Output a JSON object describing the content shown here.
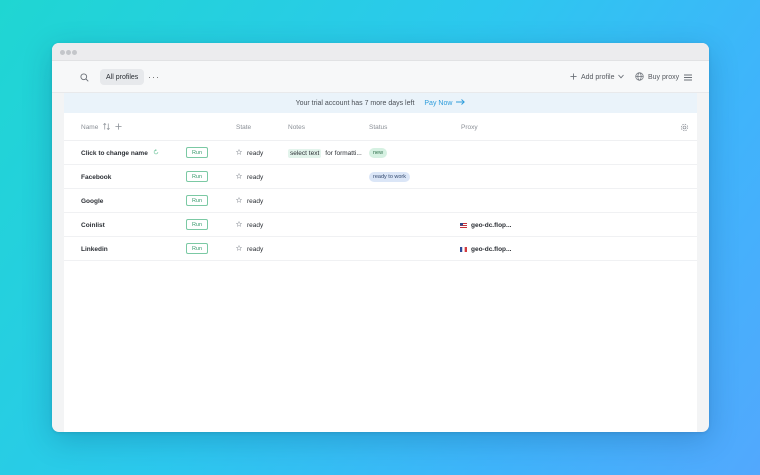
{
  "toolbar": {
    "tab_label": "All profiles",
    "more_label": "···",
    "add_profile_label": "Add profile",
    "buy_proxy_label": "Buy proxy"
  },
  "banner": {
    "text": "Your trial account has 7 more days left",
    "action_label": "Pay Now"
  },
  "table": {
    "columns": {
      "name": "Name",
      "state": "State",
      "notes": "Notes",
      "status": "Status",
      "proxy": "Proxy"
    },
    "run_label": "Run",
    "rows": [
      {
        "name": "Click to change name",
        "state": "ready",
        "notes_highlight": "select text",
        "notes_rest": "for formatti...",
        "status": "new",
        "proxy": "",
        "proxy_flag": ""
      },
      {
        "name": "Facebook",
        "state": "ready",
        "notes_highlight": "",
        "notes_rest": "",
        "status": "ready to work",
        "proxy": "",
        "proxy_flag": ""
      },
      {
        "name": "Google",
        "state": "ready",
        "notes_highlight": "",
        "notes_rest": "",
        "status": "",
        "proxy": "",
        "proxy_flag": ""
      },
      {
        "name": "Coinlist",
        "state": "ready",
        "notes_highlight": "",
        "notes_rest": "",
        "status": "",
        "proxy": "geo-dc.flop...",
        "proxy_flag": "us-flag-icon"
      },
      {
        "name": "Linkedin",
        "state": "ready",
        "notes_highlight": "",
        "notes_rest": "",
        "status": "",
        "proxy": "geo-dc.flop...",
        "proxy_flag": "fr-flag-icon"
      }
    ]
  },
  "colors": {
    "accent": "#2d9cdb",
    "run_border": "#7bc9a4",
    "badge_new": "#d6f1e2",
    "badge_work": "#dbe6f7"
  }
}
